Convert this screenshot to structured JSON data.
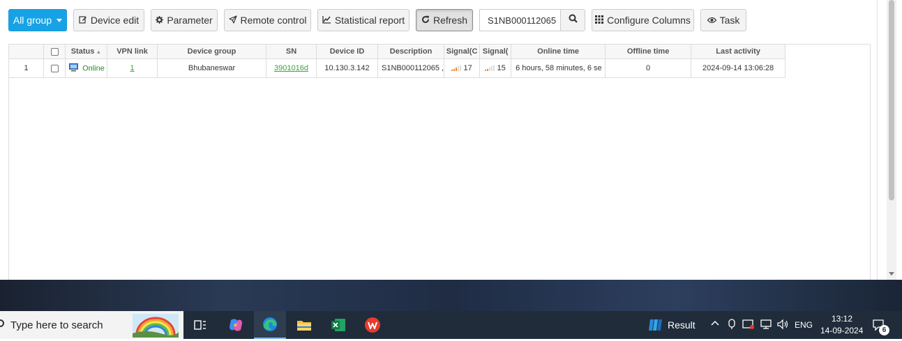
{
  "toolbar": {
    "all_group": "All group",
    "device_edit": "Device edit",
    "parameter": "Parameter",
    "remote_control": "Remote control",
    "statistical_report": "Statistical report",
    "refresh": "Refresh",
    "search_value": "S1NB000112065",
    "configure_columns": "Configure Columns",
    "task": "Task"
  },
  "table": {
    "headers": {
      "status": "Status",
      "vpn_link": "VPN link",
      "device_group": "Device group",
      "sn": "SN",
      "device_id": "Device ID",
      "description": "Description",
      "signal1": "Signal(C",
      "signal2": "Signal(",
      "online_time": "Online time",
      "offline_time": "Offline time",
      "last_activity": "Last activity"
    },
    "rows": [
      {
        "index": "1",
        "status": "Online",
        "vpn_link": "1",
        "device_group": "Bhubaneswar",
        "sn": "3901016d",
        "device_id": "10.130.3.142",
        "description": "S1NB000112065 ,",
        "signal1": "17",
        "signal2": "15",
        "online_time": "6 hours, 58 minutes, 6 se",
        "offline_time": "0",
        "last_activity": "2024-09-14 13:06:28"
      }
    ]
  },
  "taskbar": {
    "search_placeholder": "Type here to search",
    "result_label": "Result",
    "language": "ENG",
    "time": "13:12",
    "date": "14-09-2024",
    "notification_count": "6"
  }
}
